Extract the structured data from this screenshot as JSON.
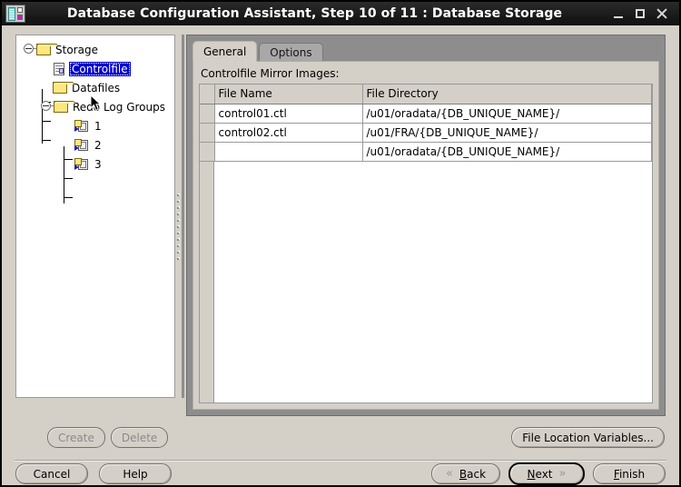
{
  "window": {
    "title": "Database Configuration Assistant, Step 10 of 11 : Database Storage",
    "icon": "database-icon",
    "minimize_label": "_",
    "maximize_label": "□",
    "close_label": "✕"
  },
  "tree": {
    "nodes": [
      {
        "label": "Storage",
        "icon": "folder-icon",
        "expanded": true
      },
      {
        "label": "Controlfile",
        "icon": "controlfile-icon",
        "selected": true
      },
      {
        "label": "Datafiles",
        "icon": "folder-icon"
      },
      {
        "label": "Redo Log Groups",
        "icon": "folder-icon",
        "expanded": true
      },
      {
        "label": "1",
        "icon": "redo-log-icon"
      },
      {
        "label": "2",
        "icon": "redo-log-icon"
      },
      {
        "label": "3",
        "icon": "redo-log-icon"
      }
    ]
  },
  "tabs": [
    {
      "label": "General",
      "active": true
    },
    {
      "label": "Options",
      "active": false
    }
  ],
  "panel": {
    "section_label": "Controlfile Mirror Images:"
  },
  "table": {
    "columns": [
      "File Name",
      "File Directory"
    ],
    "rows": [
      {
        "file_name": "control01.ctl",
        "file_directory": "/u01/oradata/{DB_UNIQUE_NAME}/"
      },
      {
        "file_name": "control02.ctl",
        "file_directory": "/u01/FRA/{DB_UNIQUE_NAME}/"
      },
      {
        "file_name": "",
        "file_directory": "/u01/oradata/{DB_UNIQUE_NAME}/"
      }
    ]
  },
  "buttons": {
    "create": "Create",
    "delete": "Delete",
    "file_location_variables": "File Location Variables...",
    "cancel": "Cancel",
    "help": "Help",
    "back": "Back",
    "back_mnemonic": "B",
    "back_rest": "ack",
    "next": "Next",
    "next_mnemonic": "N",
    "next_rest": "ext",
    "finish": "Finish",
    "finish_mnemonic": "F",
    "finish_rest": "inish",
    "back_chevron": "«",
    "next_chevron": "»"
  },
  "colors": {
    "selection_blue": "#0000cc",
    "window_bg": "#d4d0c8",
    "panel_dark": "#8d8d8d",
    "titlebar": "#1b1b1b",
    "folder_yellow": "#ffe680"
  }
}
